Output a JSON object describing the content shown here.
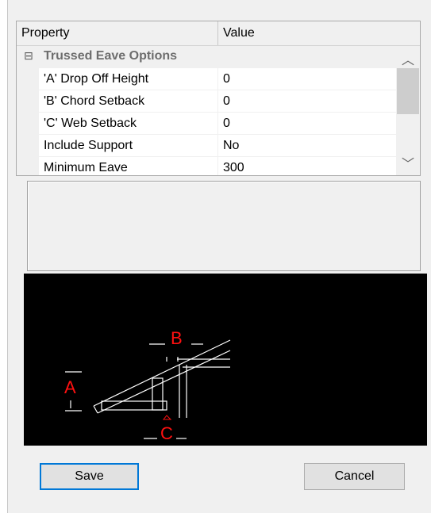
{
  "grid": {
    "header": {
      "property": "Property",
      "value": "Value"
    },
    "category": {
      "expander": "⊟",
      "label": "Trussed Eave Options"
    },
    "rows": [
      {
        "name": "'A' Drop Off Height",
        "value": "0"
      },
      {
        "name": "'B' Chord Setback",
        "value": "0"
      },
      {
        "name": "'C' Web Setback",
        "value": "0"
      },
      {
        "name": "Include Support",
        "value": "No"
      },
      {
        "name": "Minimum Eave",
        "value": "300"
      }
    ],
    "scrollbar": {
      "up_icon": "chevron-up-icon",
      "down_icon": "chevron-down-icon",
      "up_glyph": "︿",
      "down_glyph": "﹀"
    }
  },
  "diagram": {
    "labels": {
      "a": "A",
      "b": "B",
      "c": "C"
    },
    "line_color": "#ffffff",
    "label_color": "#ff1010"
  },
  "buttons": {
    "save": "Save",
    "cancel": "Cancel"
  },
  "colors": {
    "focus_border": "#0078d7",
    "dialog_bg": "#f0f0f0"
  }
}
